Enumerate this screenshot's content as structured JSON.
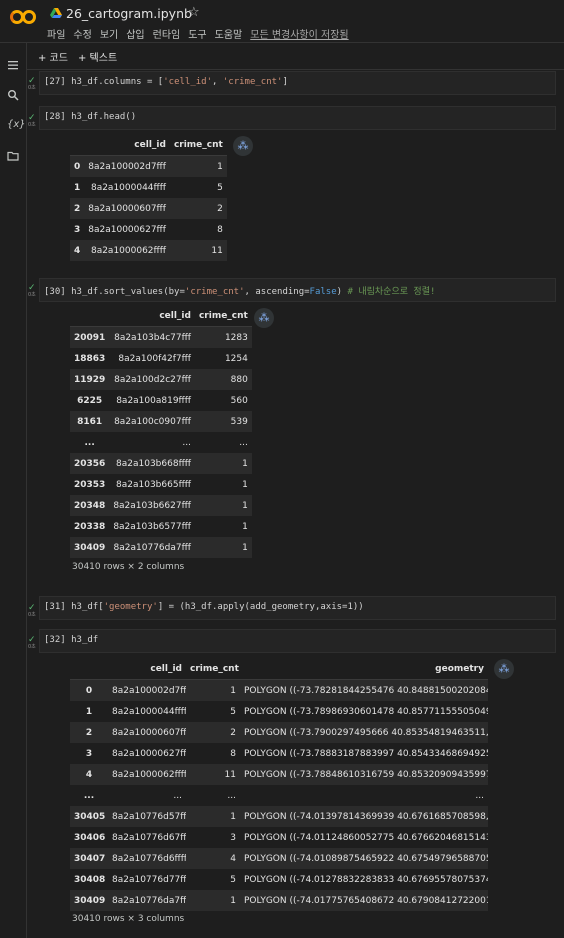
{
  "header": {
    "title": "26_cartogram.ipynb",
    "menu": [
      "파일",
      "수정",
      "보기",
      "삽입",
      "런타임",
      "도구",
      "도움말"
    ],
    "saved_status": "모든 변경사항이 저장됨"
  },
  "toolbar": {
    "add_code": "+ 코드",
    "add_text": "+ 텍스트"
  },
  "rail": {
    "icons": [
      "menu-icon",
      "search-icon",
      "variables-icon",
      "folder-icon"
    ],
    "variables_label": "{x}"
  },
  "cells": {
    "c27": {
      "prompt": "[27]",
      "code_a": "h3_df.columns = [",
      "str1": "'cell_id'",
      "sep": ", ",
      "str2": "'crime_cnt'",
      "code_b": "]"
    },
    "c28": {
      "prompt": "[28]",
      "code": "h3_df.head()"
    },
    "c30": {
      "prompt": "[30]",
      "code_a": "h3_df.sort_values(by=",
      "str1": "'crime_cnt'",
      "code_b": ", ascending=",
      "kw": "False",
      "code_c": ") ",
      "comment": "# 내림차순으로 정렬!"
    },
    "c31": {
      "prompt": "[31]",
      "code_a": "h3_df[",
      "str1": "'geometry'",
      "code_b": "] = (h3_df.apply(add_geometry,axis=1))"
    },
    "c32": {
      "prompt": "[32]",
      "code": "h3_df"
    }
  },
  "gutter": {
    "check": "✓",
    "time": "0초"
  },
  "table_head": {
    "columns": [
      "",
      "cell_id",
      "crime_cnt"
    ],
    "rows": [
      [
        "0",
        "8a2a100002d7fff",
        "1"
      ],
      [
        "1",
        "8a2a1000044ffff",
        "5"
      ],
      [
        "2",
        "8a2a10000607fff",
        "2"
      ],
      [
        "3",
        "8a2a10000627fff",
        "8"
      ],
      [
        "4",
        "8a2a1000062ffff",
        "11"
      ]
    ]
  },
  "table_sorted": {
    "columns": [
      "",
      "cell_id",
      "crime_cnt"
    ],
    "rows": [
      [
        "20091",
        "8a2a103b4c77fff",
        "1283"
      ],
      [
        "18863",
        "8a2a100f42f7fff",
        "1254"
      ],
      [
        "11929",
        "8a2a100d2c27fff",
        "880"
      ],
      [
        "6225",
        "8a2a100a819ffff",
        "560"
      ],
      [
        "8161",
        "8a2a100c0907fff",
        "539"
      ],
      [
        "...",
        "...",
        "..."
      ],
      [
        "20356",
        "8a2a103b668ffff",
        "1"
      ],
      [
        "20353",
        "8a2a103b665ffff",
        "1"
      ],
      [
        "20348",
        "8a2a103b6627fff",
        "1"
      ],
      [
        "20338",
        "8a2a103b6577fff",
        "1"
      ],
      [
        "30409",
        "8a2a10776da7fff",
        "1"
      ]
    ],
    "shape": "30410 rows × 2 columns"
  },
  "table_geo": {
    "columns": [
      "",
      "cell_id",
      "crime_cnt",
      "geometry"
    ],
    "rows": [
      [
        "0",
        "8a2a100002d7fff",
        "1",
        "POLYGON ((-73.78281844255476 40.84881500202084..."
      ],
      [
        "1",
        "8a2a1000044ffff",
        "5",
        "POLYGON ((-73.78986930601478 40.85771155505049..."
      ],
      [
        "2",
        "8a2a10000607fff",
        "2",
        "POLYGON ((-73.7900297495666 40.85354819463511,..."
      ],
      [
        "3",
        "8a2a10000627fff",
        "8",
        "POLYGON ((-73.78883187883997 40.85433468694925..."
      ],
      [
        "4",
        "8a2a1000062ffff",
        "11",
        "POLYGON ((-73.78848610316759 40.85320909435997..."
      ],
      [
        "...",
        "...",
        "...",
        "..."
      ],
      [
        "30405",
        "8a2a10776d57fff",
        "1",
        "POLYGON ((-74.01397814369939 40.6761685708598,..."
      ],
      [
        "30406",
        "8a2a10776d67fff",
        "3",
        "POLYGON ((-74.01124860052775 40.67662046815143..."
      ],
      [
        "30407",
        "8a2a10776d6ffff",
        "4",
        "POLYGON ((-74.01089875465922 40.67549796588705..."
      ],
      [
        "30408",
        "8a2a10776d77fff",
        "5",
        "POLYGON ((-74.01278832283833 40.67695578075374..."
      ],
      [
        "30409",
        "8a2a10776da7fff",
        "1",
        "POLYGON ((-74.01775765408672 40.67908412722001..."
      ]
    ],
    "shape": "30410 rows × 3 columns"
  }
}
